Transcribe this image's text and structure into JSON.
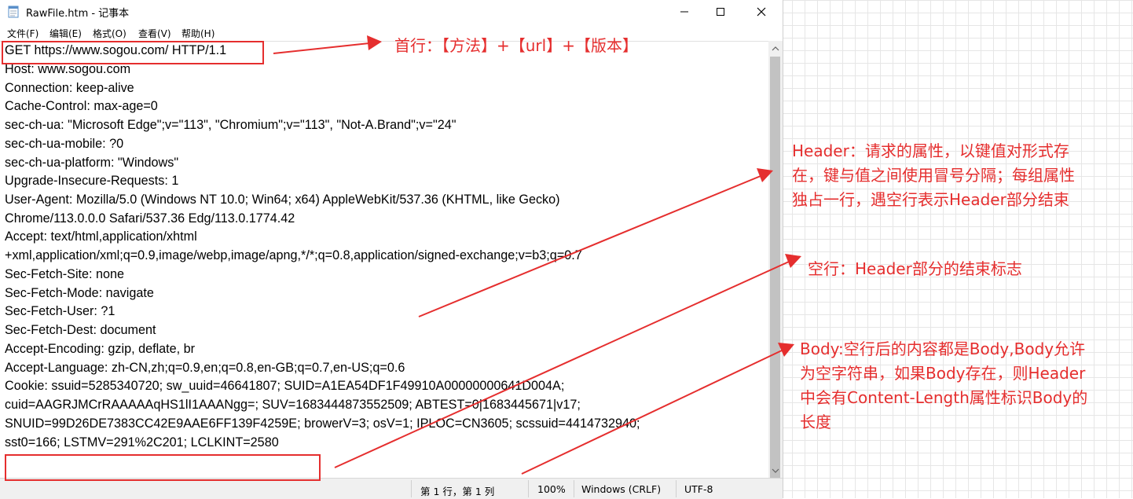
{
  "window": {
    "title": "RawFile.htm - 记事本",
    "menu": [
      "文件(F)",
      "编辑(E)",
      "格式(O)",
      "查看(V)",
      "帮助(H)"
    ]
  },
  "editor_lines": [
    "GET https://www.sogou.com/ HTTP/1.1",
    "Host: www.sogou.com",
    "Connection: keep-alive",
    "Cache-Control: max-age=0",
    "sec-ch-ua: \"Microsoft Edge\";v=\"113\", \"Chromium\";v=\"113\", \"Not-A.Brand\";v=\"24\"",
    "sec-ch-ua-mobile: ?0",
    "sec-ch-ua-platform: \"Windows\"",
    "Upgrade-Insecure-Requests: 1",
    "User-Agent: Mozilla/5.0 (Windows NT 10.0; Win64; x64) AppleWebKit/537.36 (KHTML, like Gecko)",
    "Chrome/113.0.0.0 Safari/537.36 Edg/113.0.1774.42",
    "Accept: text/html,application/xhtml",
    "+xml,application/xml;q=0.9,image/webp,image/apng,*/*;q=0.8,application/signed-exchange;v=b3;q=0.7",
    "Sec-Fetch-Site: none",
    "Sec-Fetch-Mode: navigate",
    "Sec-Fetch-User: ?1",
    "Sec-Fetch-Dest: document",
    "Accept-Encoding: gzip, deflate, br",
    "Accept-Language: zh-CN,zh;q=0.9,en;q=0.8,en-GB;q=0.7,en-US;q=0.6",
    "Cookie: ssuid=5285340720; sw_uuid=46641807; SUID=A1EA54DF1F49910A00000000641D004A;",
    "cuid=AAGRJMCrRAAAAAqHS1lI1AAANgg=; SUV=1683444873552509; ABTEST=0|1683445671|v17;",
    "SNUID=99D26DE7383CC42E9AAE6FF139F4259E; browerV=3; osV=1; IPLOC=CN3605; scssuid=4414732940;",
    "sst0=166; LSTMV=291%2C201; LCLKINT=2580"
  ],
  "status": {
    "position": "第 1 行，第 1 列",
    "zoom": "100%",
    "line_ending": "Windows (CRLF)",
    "encoding": "UTF-8"
  },
  "annotations": {
    "first_line": "首行：【方法】+【url】+【版本】",
    "header": [
      "Header：请求的属性，以键值对形式存",
      "在，键与值之间使用冒号分隔；每组属性",
      "独占一行，遇空行表示Header部分结束"
    ],
    "blank_line": "空行：Header部分的结束标志",
    "body": [
      "Body:空行后的内容都是Body,Body允许",
      "为空字符串，如果Body存在，则Header",
      "中会有Content-Length属性标识Body的",
      "长度"
    ]
  },
  "colors": {
    "annotation": "#e52e2e"
  }
}
